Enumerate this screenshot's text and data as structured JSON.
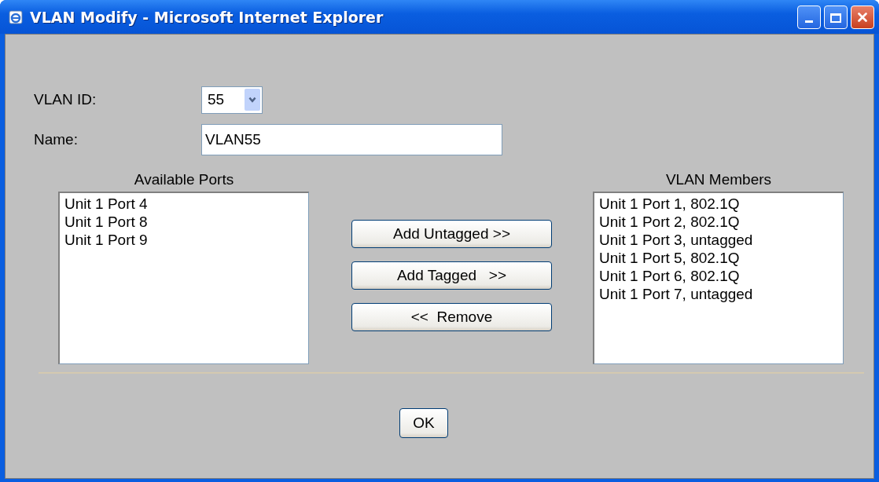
{
  "window": {
    "title": "VLAN Modify - Microsoft Internet Explorer"
  },
  "vlan_id": {
    "label": "VLAN ID:",
    "value": "55"
  },
  "name": {
    "label": "Name:",
    "value": "VLAN55"
  },
  "available_ports": {
    "heading": "Available Ports",
    "items": [
      "Unit 1 Port 4",
      "Unit 1 Port 8",
      "Unit 1 Port 9"
    ]
  },
  "buttons": [
    "Add Untagged >>",
    "Add Tagged   >>",
    "<<  Remove"
  ],
  "vlan_members": {
    "heading": "VLAN Members",
    "items": [
      "Unit 1 Port 1, 802.1Q",
      "Unit 1 Port 2, 802.1Q",
      "Unit 1 Port 3, untagged",
      "Unit 1 Port 5, 802.1Q",
      "Unit 1 Port 6, 802.1Q",
      "Unit 1 Port 7, untagged"
    ]
  },
  "ok_button": "OK"
}
